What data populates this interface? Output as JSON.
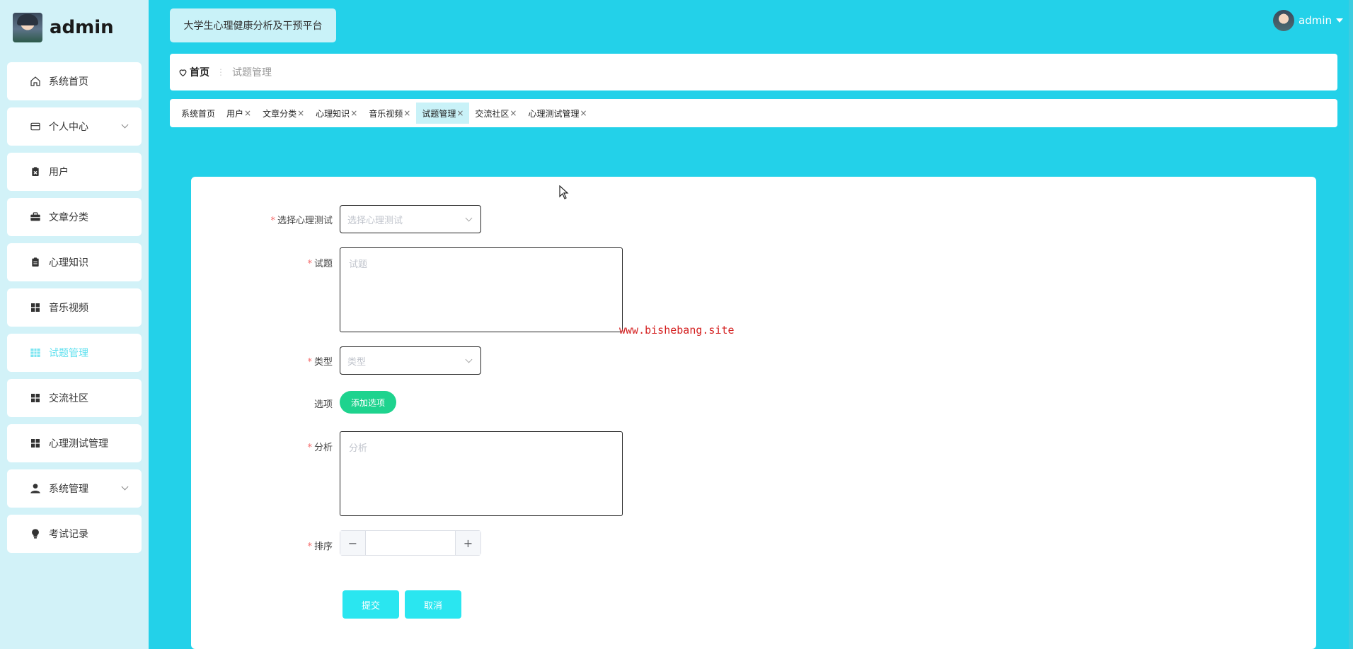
{
  "sidebar": {
    "brand": "admin",
    "items": [
      {
        "label": "系统首页",
        "icon": "home-icon",
        "chevron": false,
        "active": false
      },
      {
        "label": "个人中心",
        "icon": "card-icon",
        "chevron": true,
        "active": false
      },
      {
        "label": "用户",
        "icon": "clipboard-x-icon",
        "chevron": false,
        "active": false
      },
      {
        "label": "文章分类",
        "icon": "briefcase-icon",
        "chevron": false,
        "active": false
      },
      {
        "label": "心理知识",
        "icon": "clipboard-icon",
        "chevron": false,
        "active": false
      },
      {
        "label": "音乐视频",
        "icon": "grid-icon",
        "chevron": false,
        "active": false
      },
      {
        "label": "试题管理",
        "icon": "table-icon",
        "chevron": false,
        "active": true
      },
      {
        "label": "交流社区",
        "icon": "grid-icon",
        "chevron": false,
        "active": false
      },
      {
        "label": "心理测试管理",
        "icon": "grid-icon",
        "chevron": false,
        "active": false
      },
      {
        "label": "系统管理",
        "icon": "user-icon",
        "chevron": true,
        "active": false
      },
      {
        "label": "考试记录",
        "icon": "bulb-icon",
        "chevron": false,
        "active": false
      }
    ]
  },
  "header": {
    "platform_title": "大学生心理健康分析及干预平台",
    "username": "admin"
  },
  "breadcrumb": {
    "home": "首页",
    "current": "试题管理"
  },
  "tabs": [
    {
      "label": "系统首页",
      "closable": false,
      "active": false
    },
    {
      "label": "用户",
      "closable": true,
      "active": false
    },
    {
      "label": "文章分类",
      "closable": true,
      "active": false
    },
    {
      "label": "心理知识",
      "closable": true,
      "active": false
    },
    {
      "label": "音乐视频",
      "closable": true,
      "active": false
    },
    {
      "label": "试题管理",
      "closable": true,
      "active": true
    },
    {
      "label": "交流社区",
      "closable": true,
      "active": false
    },
    {
      "label": "心理测试管理",
      "closable": true,
      "active": false
    }
  ],
  "form": {
    "test_label": "选择心理测试",
    "test_placeholder": "选择心理测试",
    "question_label": "试题",
    "question_placeholder": "试题",
    "type_label": "类型",
    "type_placeholder": "类型",
    "options_label": "选项",
    "add_option_button": "添加选项",
    "analysis_label": "分析",
    "analysis_placeholder": "分析",
    "order_label": "排序",
    "order_value": "",
    "minus": "−",
    "plus": "+",
    "submit_button": "提交",
    "cancel_button": "取消",
    "required_mark": "*"
  },
  "watermark": "www.bishebang.site",
  "tab_close_glyph": "×"
}
